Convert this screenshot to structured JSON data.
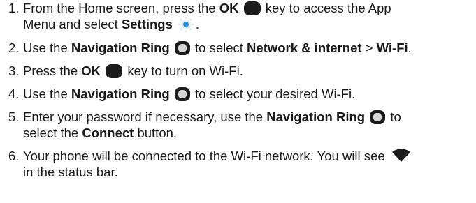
{
  "steps": [
    {
      "num": "1.",
      "a": "From the Home screen, press the ",
      "b": "OK",
      "c": " key to access the App",
      "d": "Menu and select ",
      "e": "Settings",
      "f": "."
    },
    {
      "num": "2.",
      "a": "Use the ",
      "b": "Navigation Ring",
      "c": " to select ",
      "d": "Network & internet",
      "e": " > ",
      "f": "Wi-Fi",
      "g": "."
    },
    {
      "num": "3.",
      "a": "Press the ",
      "b": "OK",
      "c": " key to turn on Wi-Fi."
    },
    {
      "num": "4.",
      "a": "Use the ",
      "b": "Navigation Ring",
      "c": " to select your desired Wi-Fi."
    },
    {
      "num": "5.",
      "a": "Enter your password if necessary, use the ",
      "b": "Navigation Ring",
      "c": " to",
      "d": "select the ",
      "e": "Connect",
      "f": " button."
    },
    {
      "num": "6.",
      "a": "Your phone will be connected to the Wi-Fi network. You will see",
      "b": "in the status bar."
    }
  ],
  "icons": {
    "ok_key": "ok-key-icon",
    "navigation_ring": "navigation-ring-icon",
    "settings": "settings-gear-icon",
    "wifi": "wifi-signal-icon"
  },
  "colors": {
    "text": "#1a1a1a",
    "key": "#1c1c1c",
    "settings_blue": "#2f8fd6"
  }
}
